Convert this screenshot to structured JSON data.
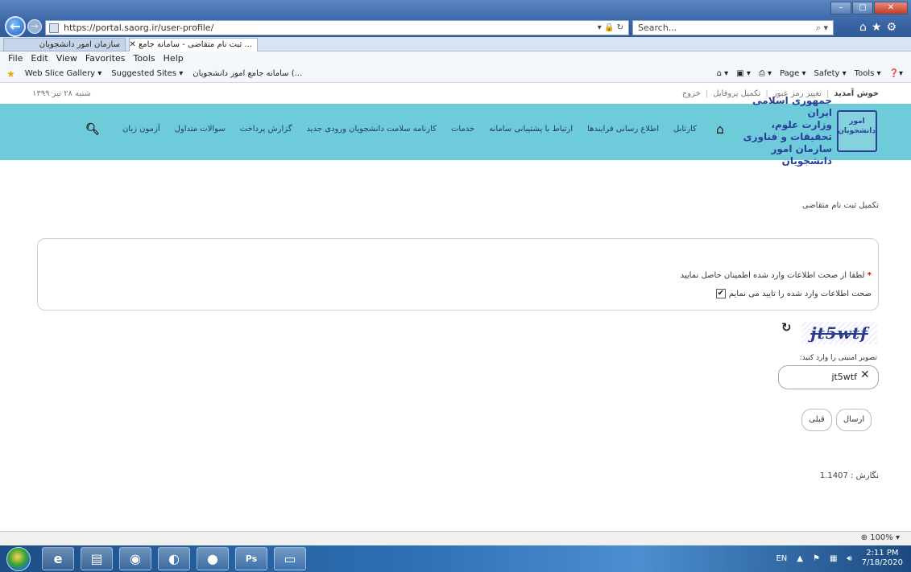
{
  "browser": {
    "url": "https://portal.saorg.ir/user-profile/",
    "search_placeholder": "Search...",
    "tabs": [
      {
        "label": "سازمان امور دانشجویان"
      },
      {
        "label": "... ثبت نام متقاضی - سامانه جامع"
      }
    ],
    "menu": [
      "File",
      "Edit",
      "View",
      "Favorites",
      "Tools",
      "Help"
    ],
    "favorites": [
      "Web Slice Gallery ▾",
      "Suggested Sites ▾",
      "سامانه جامع امور دانشجویان (..."
    ],
    "command_bar": [
      "Page ▾",
      "Safety ▾",
      "Tools ▾"
    ],
    "zoom": "100%"
  },
  "util": {
    "date": "۱۳۹۹ شنبه ۲۸ تیر",
    "welcome": "خوش آمدید",
    "links": [
      "تغییر رمز عبور",
      "تکمیل پروفایل",
      "خروج"
    ]
  },
  "header": {
    "logo_emblem": "امور دانشجویان",
    "logo_lines": [
      "جمهوری اسلامی ایران",
      "وزارت علوم، تحقیقات و فناوری",
      "سازمان امور دانشجویان"
    ],
    "nav": [
      "کارتابل",
      "اطلاع رسانی فرایندها",
      "ارتباط با پشتیبانی سامانه",
      "خدمات",
      "کارنامه سلامت دانشجویان ورودی جدید",
      "گزارش پرداخت",
      "سوالات متداول",
      "آزمون زبان"
    ]
  },
  "page": {
    "title": "تکمیل ثبت نام متقاضی",
    "notice": "لطفا از صحت اطلاعات وارد شده اطمینان حاصل نمایید",
    "checkbox_label": "صحت اطلاعات وارد شده را تایید می نمایم",
    "checkbox_mark": "✔",
    "captcha_image_text": "jt5wtf",
    "captcha_label": "تصویر امنیتی را وارد کنید:",
    "captcha_value": "jt5wtf",
    "submit_label": "ارسال",
    "prev_label": "قبلی",
    "version": "نگارش : 1.1407"
  },
  "taskbar": {
    "lang": "EN",
    "time": "2:11 PM",
    "date": "7/18/2020"
  }
}
